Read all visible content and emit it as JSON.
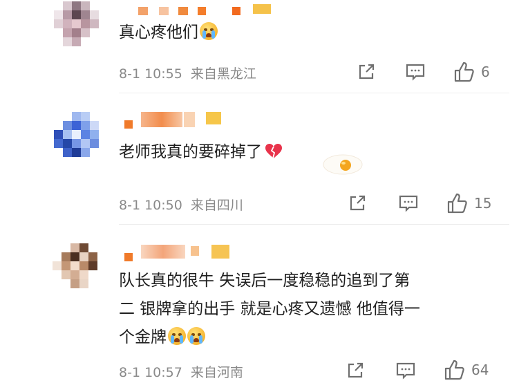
{
  "comments": [
    {
      "text": "真心疼他们",
      "time": "8-1 10:55",
      "location": "来自黑龙江",
      "likes": "6",
      "emoji": [
        "crying-face"
      ]
    },
    {
      "text": "老师我真的要碎掉了",
      "time": "8-1 10:50",
      "location": "来自四川",
      "likes": "15",
      "emoji": [
        "broken-heart"
      ]
    },
    {
      "text_lines": [
        "队长真的很牛 失误后一度稳稳的追到了第",
        "二 银牌拿的出手 就是心疼又遗憾 他值得一",
        "个金牌"
      ],
      "time": "8-1 10:57",
      "location": "来自河南",
      "likes": "64",
      "emoji": [
        "crying-face",
        "crying-face"
      ]
    }
  ],
  "icons": {
    "share": "share-icon",
    "reply": "comment-icon",
    "like": "thumbs-up-icon"
  },
  "colors": {
    "accent_orange": "#f07a2a",
    "meta_gray": "#8a8a8a",
    "icon_gray": "#7a7a7a"
  }
}
